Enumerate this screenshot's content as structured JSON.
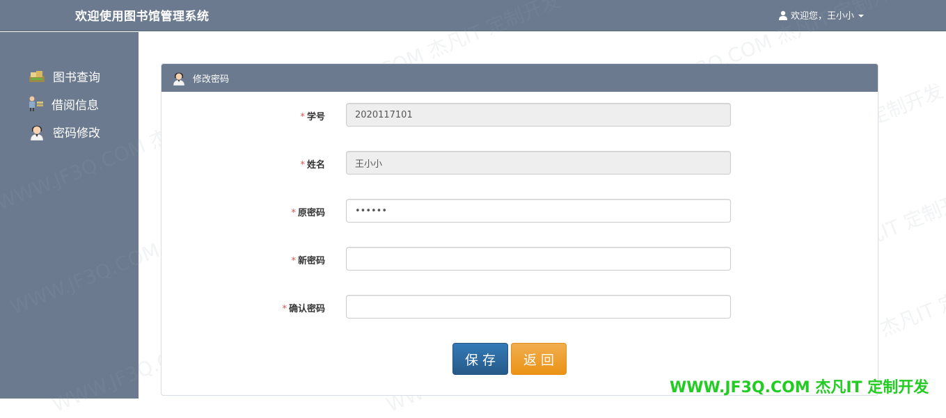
{
  "header": {
    "title": "欢迎使用图书馆管理系统",
    "user_greeting": "欢迎您，王小小"
  },
  "sidebar": {
    "items": [
      {
        "label": "图书查询",
        "icon": "books-icon"
      },
      {
        "label": "借阅信息",
        "icon": "people-icon"
      },
      {
        "label": "密码修改",
        "icon": "user-avatar-icon"
      }
    ]
  },
  "panel": {
    "title": "修改密码"
  },
  "form": {
    "student_id": {
      "label": "学号",
      "value": "2020117101"
    },
    "name": {
      "label": "姓名",
      "value": "王小小"
    },
    "old_password": {
      "label": "原密码",
      "value": "••••••"
    },
    "new_password": {
      "label": "新密码",
      "value": ""
    },
    "confirm_password": {
      "label": "确认密码",
      "value": ""
    },
    "required_mark": "*"
  },
  "buttons": {
    "save": "保存",
    "back": "返回"
  },
  "watermark": {
    "text": "WWW.JF3Q.COM 杰凡IT 定制开发",
    "footer": "WWW.JF3Q.COM 杰凡IT  定制开发"
  },
  "colors": {
    "header_bg": "#6b7a8f",
    "save_button": "#265a88",
    "back_button": "#eb9316",
    "required_star": "#d9534f",
    "footer_watermark": "#22cc22"
  }
}
